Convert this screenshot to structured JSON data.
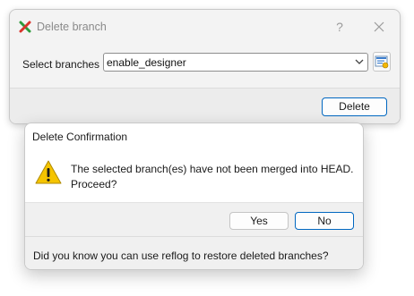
{
  "main_dialog": {
    "title": "Delete branch",
    "help_glyph": "?",
    "select_label": "Select branches",
    "selected_branch": "enable_designer",
    "delete_label": "Delete",
    "icons": {
      "app": "git-x-icon",
      "help": "help-icon",
      "close": "close-icon",
      "dropdown": "chevron-down-icon",
      "browse": "branch-list-icon"
    }
  },
  "confirm_dialog": {
    "title": "Delete Confirmation",
    "message_line1": "The selected branch(es) have not been merged into HEAD.",
    "message_line2": "Proceed?",
    "yes_label": "Yes",
    "no_label": "No",
    "tip": "Did you know you can use reflog to restore deleted branches?",
    "icons": {
      "warning": "warning-icon"
    }
  },
  "colors": {
    "accent": "#0067c0",
    "warning_fill": "#f5c400",
    "app_icon_green": "#2e9b3c",
    "app_icon_red": "#d9342b"
  }
}
